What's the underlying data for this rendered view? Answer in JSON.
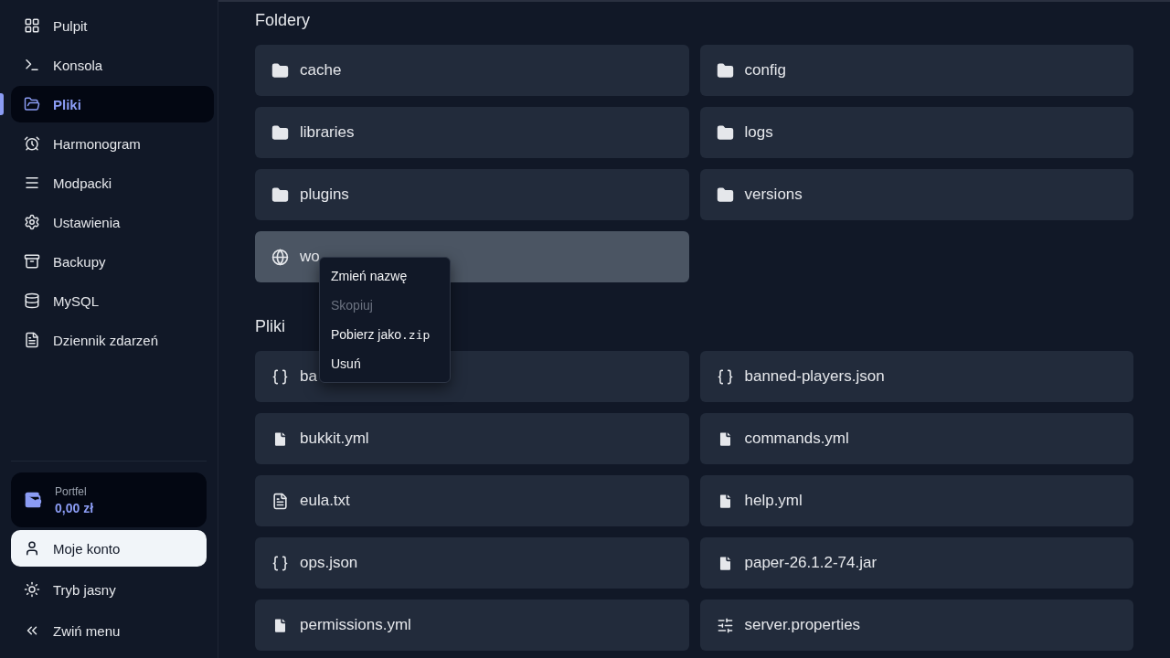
{
  "sidebar": {
    "items": [
      {
        "label": "Pulpit",
        "selected": false
      },
      {
        "label": "Konsola",
        "selected": false
      },
      {
        "label": "Pliki",
        "selected": true
      },
      {
        "label": "Harmonogram",
        "selected": false
      },
      {
        "label": "Modpacki",
        "selected": false
      },
      {
        "label": "Ustawienia",
        "selected": false
      },
      {
        "label": "Backupy",
        "selected": false
      },
      {
        "label": "MySQL",
        "selected": false
      },
      {
        "label": "Dziennik zdarzeń",
        "selected": false
      }
    ],
    "wallet": {
      "label": "Portfel",
      "amount": "0,00 zł"
    },
    "bottom": [
      {
        "label": "Moje konto",
        "selected": true
      },
      {
        "label": "Tryb jasny",
        "selected": false
      },
      {
        "label": "Zwiń menu",
        "selected": false
      }
    ]
  },
  "sections": [
    {
      "title": "Foldery",
      "items": [
        {
          "name": "cache",
          "kind": "folder",
          "selected": false
        },
        {
          "name": "config",
          "kind": "folder",
          "selected": false
        },
        {
          "name": "libraries",
          "kind": "folder",
          "selected": false
        },
        {
          "name": "logs",
          "kind": "folder",
          "selected": false
        },
        {
          "name": "plugins",
          "kind": "folder",
          "selected": false
        },
        {
          "name": "versions",
          "kind": "folder",
          "selected": false
        },
        {
          "name": "wo",
          "kind": "world",
          "selected": true
        }
      ]
    },
    {
      "title": "Pliki",
      "items": [
        {
          "name": "ba",
          "kind": "json",
          "selected": false
        },
        {
          "name": "banned-players.json",
          "kind": "json",
          "selected": false
        },
        {
          "name": "bukkit.yml",
          "kind": "file",
          "selected": false
        },
        {
          "name": "commands.yml",
          "kind": "file",
          "selected": false
        },
        {
          "name": "eula.txt",
          "kind": "text",
          "selected": false
        },
        {
          "name": "help.yml",
          "kind": "file",
          "selected": false
        },
        {
          "name": "ops.json",
          "kind": "json",
          "selected": false
        },
        {
          "name": "paper-26.1.2-74.jar",
          "kind": "file",
          "selected": false
        },
        {
          "name": "permissions.yml",
          "kind": "file",
          "selected": false
        },
        {
          "name": "server.properties",
          "kind": "properties",
          "selected": false
        }
      ]
    }
  ],
  "context_menu": {
    "items": [
      {
        "label": "Zmień nazwę",
        "disabled": false
      },
      {
        "label": "Skopiuj",
        "disabled": true
      },
      {
        "label": "Pobierz jako",
        "suffix": ".zip",
        "disabled": false
      },
      {
        "label": "Usuń",
        "disabled": false
      }
    ]
  }
}
